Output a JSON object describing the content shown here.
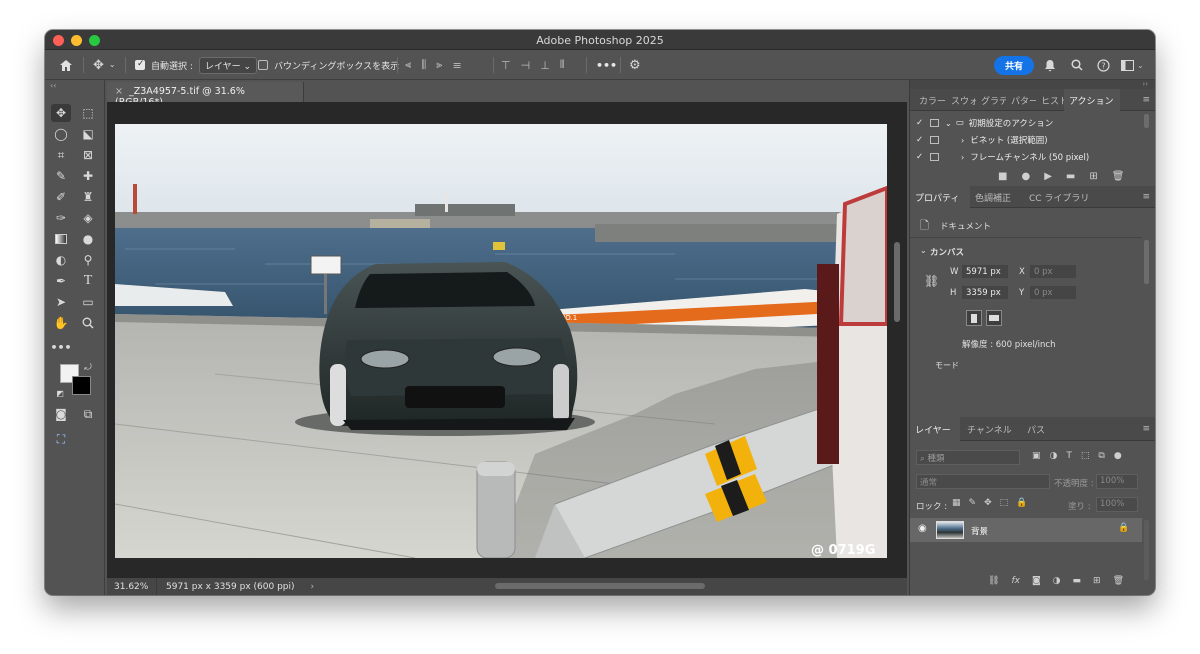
{
  "window": {
    "title": "Adobe Photoshop 2025"
  },
  "options_bar": {
    "auto_select_label": "自動選択 :",
    "auto_select_value": "レイヤー",
    "bounding_box_label": "バウンディングボックスを表示",
    "more": "•••",
    "share_label": "共有"
  },
  "tools": {
    "more": "•••",
    "collapse": "‹‹"
  },
  "document": {
    "tab_close": "×",
    "tab_title": "_Z3A4957-5.tif @ 31.6% (RGB/16*)",
    "watermark": "@  0719G",
    "zoom": "31.62%",
    "info": "5971 px x 3359 px (600 ppi)",
    "info_arrow": "›"
  },
  "panel_group1": {
    "tabs": [
      "カラー",
      "スウォ",
      "グラデ",
      "パター",
      "ヒスト",
      "アクション"
    ],
    "actions": [
      {
        "label": "初期設定のアクション",
        "type": "set"
      },
      {
        "label": "ビネット (選択範囲)",
        "type": "action"
      },
      {
        "label": "フレームチャンネル (50 pixel)",
        "type": "action"
      }
    ]
  },
  "panel_group2": {
    "tabs": [
      "プロパティ",
      "色調補正",
      "CC ライブラリ"
    ],
    "doc_label": "ドキュメント",
    "canvas_label": "カンバス",
    "w_label": "W",
    "w_value": "5971 px",
    "h_label": "H",
    "h_value": "3359 px",
    "x_label": "X",
    "x_value": "0 px",
    "y_label": "Y",
    "y_value": "0 px",
    "resolution": "解像度 : 600 pixel/inch",
    "mode": "モード"
  },
  "panel_group3": {
    "tabs": [
      "レイヤー",
      "チャンネル",
      "パス"
    ],
    "filter_placeholder": "種類",
    "blend_mode": "通常",
    "opacity_label": "不透明度 :",
    "opacity_value": "100%",
    "lock_label": "ロック :",
    "fill_label": "塗り :",
    "fill_value": "100%",
    "layer_name": "背景"
  },
  "colors": {
    "accent": "#1473e6",
    "panel": "#535353",
    "canvas": "#282828"
  }
}
